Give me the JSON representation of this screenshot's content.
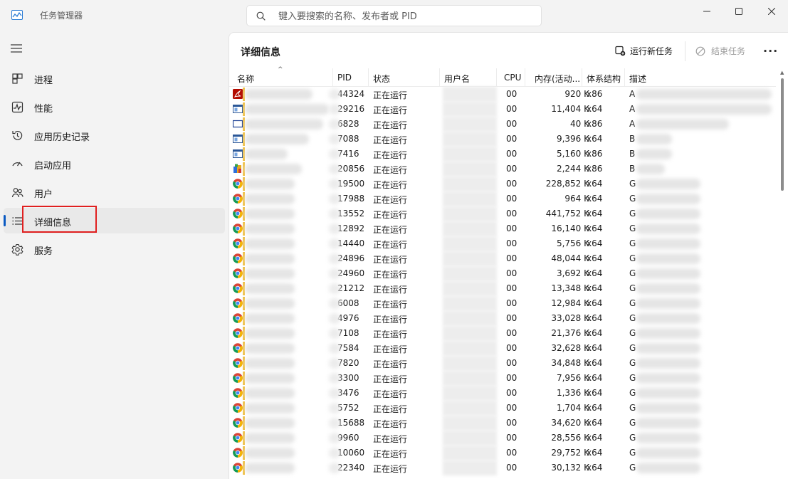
{
  "window": {
    "title": "任务管理器"
  },
  "search": {
    "placeholder": "键入要搜索的名称、发布者或 PID"
  },
  "sidebar": {
    "items": [
      {
        "label": "进程",
        "icon": "processes-icon"
      },
      {
        "label": "性能",
        "icon": "performance-icon"
      },
      {
        "label": "应用历史记录",
        "icon": "app-history-icon"
      },
      {
        "label": "启动应用",
        "icon": "startup-apps-icon"
      },
      {
        "label": "用户",
        "icon": "users-icon"
      },
      {
        "label": "详细信息",
        "icon": "details-icon",
        "active": true
      },
      {
        "label": "服务",
        "icon": "services-icon"
      }
    ]
  },
  "main": {
    "title": "详细信息",
    "run_new_task": "运行新任务",
    "end_task": "结束任务",
    "more": "···"
  },
  "colors": {
    "accent": "#0a5ac2",
    "highlight": "#e02020"
  },
  "table": {
    "headers": {
      "name": "名称",
      "pid": "PID",
      "status": "状态",
      "user": "用户名",
      "cpu": "CPU",
      "mem": "内存(活动...",
      "arch": "体系结构",
      "desc": "描述"
    },
    "rows": [
      {
        "icon": "pdf-icon",
        "pid": "44324",
        "status": "正在运行",
        "cpu": "00",
        "mem": "920 K",
        "arch": "x86",
        "desc": "A"
      },
      {
        "icon": "app-window-icon",
        "pid": "29216",
        "status": "正在运行",
        "cpu": "00",
        "mem": "11,404 K",
        "arch": "x64",
        "desc": "A"
      },
      {
        "icon": "blank-window-icon",
        "pid": "6828",
        "status": "正在运行",
        "cpu": "00",
        "mem": "40 K",
        "arch": "x86",
        "desc": "A"
      },
      {
        "icon": "app-window-icon",
        "pid": "7088",
        "status": "正在运行",
        "cpu": "00",
        "mem": "9,396 K",
        "arch": "x64",
        "desc": "B"
      },
      {
        "icon": "app-window-icon",
        "pid": "7416",
        "status": "正在运行",
        "cpu": "00",
        "mem": "5,160 K",
        "arch": "x86",
        "desc": "B"
      },
      {
        "icon": "installer-icon",
        "pid": "20856",
        "status": "正在运行",
        "cpu": "00",
        "mem": "2,244 K",
        "arch": "x86",
        "desc": "B"
      },
      {
        "icon": "chrome-icon",
        "pid": "19500",
        "status": "正在运行",
        "cpu": "00",
        "mem": "228,852 K",
        "arch": "x64",
        "desc": "G"
      },
      {
        "icon": "chrome-icon",
        "pid": "17988",
        "status": "正在运行",
        "cpu": "00",
        "mem": "964 K",
        "arch": "x64",
        "desc": "G"
      },
      {
        "icon": "chrome-icon",
        "pid": "13552",
        "status": "正在运行",
        "cpu": "00",
        "mem": "441,752 K",
        "arch": "x64",
        "desc": "G"
      },
      {
        "icon": "chrome-icon",
        "pid": "12892",
        "status": "正在运行",
        "cpu": "00",
        "mem": "16,140 K",
        "arch": "x64",
        "desc": "G"
      },
      {
        "icon": "chrome-icon",
        "pid": "14440",
        "status": "正在运行",
        "cpu": "00",
        "mem": "5,756 K",
        "arch": "x64",
        "desc": "G"
      },
      {
        "icon": "chrome-icon",
        "pid": "24896",
        "status": "正在运行",
        "cpu": "00",
        "mem": "48,044 K",
        "arch": "x64",
        "desc": "G"
      },
      {
        "icon": "chrome-icon",
        "pid": "24960",
        "status": "正在运行",
        "cpu": "00",
        "mem": "3,692 K",
        "arch": "x64",
        "desc": "G"
      },
      {
        "icon": "chrome-icon",
        "pid": "21212",
        "status": "正在运行",
        "cpu": "00",
        "mem": "13,348 K",
        "arch": "x64",
        "desc": "G"
      },
      {
        "icon": "chrome-icon",
        "pid": "6008",
        "status": "正在运行",
        "cpu": "00",
        "mem": "12,984 K",
        "arch": "x64",
        "desc": "G"
      },
      {
        "icon": "chrome-icon",
        "pid": "4976",
        "status": "正在运行",
        "cpu": "00",
        "mem": "33,028 K",
        "arch": "x64",
        "desc": "G"
      },
      {
        "icon": "chrome-icon",
        "pid": "7108",
        "status": "正在运行",
        "cpu": "00",
        "mem": "21,376 K",
        "arch": "x64",
        "desc": "G"
      },
      {
        "icon": "chrome-icon",
        "pid": "7584",
        "status": "正在运行",
        "cpu": "00",
        "mem": "32,628 K",
        "arch": "x64",
        "desc": "G"
      },
      {
        "icon": "chrome-icon",
        "pid": "7820",
        "status": "正在运行",
        "cpu": "00",
        "mem": "34,848 K",
        "arch": "x64",
        "desc": "G"
      },
      {
        "icon": "chrome-icon",
        "pid": "3300",
        "status": "正在运行",
        "cpu": "00",
        "mem": "7,956 K",
        "arch": "x64",
        "desc": "G"
      },
      {
        "icon": "chrome-icon",
        "pid": "3476",
        "status": "正在运行",
        "cpu": "00",
        "mem": "1,336 K",
        "arch": "x64",
        "desc": "G"
      },
      {
        "icon": "chrome-icon",
        "pid": "5752",
        "status": "正在运行",
        "cpu": "00",
        "mem": "1,704 K",
        "arch": "x64",
        "desc": "G"
      },
      {
        "icon": "chrome-icon",
        "pid": "15688",
        "status": "正在运行",
        "cpu": "00",
        "mem": "34,620 K",
        "arch": "x64",
        "desc": "G"
      },
      {
        "icon": "chrome-icon",
        "pid": "9960",
        "status": "正在运行",
        "cpu": "00",
        "mem": "28,556 K",
        "arch": "x64",
        "desc": "G"
      },
      {
        "icon": "chrome-icon",
        "pid": "10060",
        "status": "正在运行",
        "cpu": "00",
        "mem": "29,752 K",
        "arch": "x64",
        "desc": "G"
      },
      {
        "icon": "chrome-icon",
        "pid": "22340",
        "status": "正在运行",
        "cpu": "00",
        "mem": "30,132 K",
        "arch": "x64",
        "desc": "G"
      }
    ]
  }
}
